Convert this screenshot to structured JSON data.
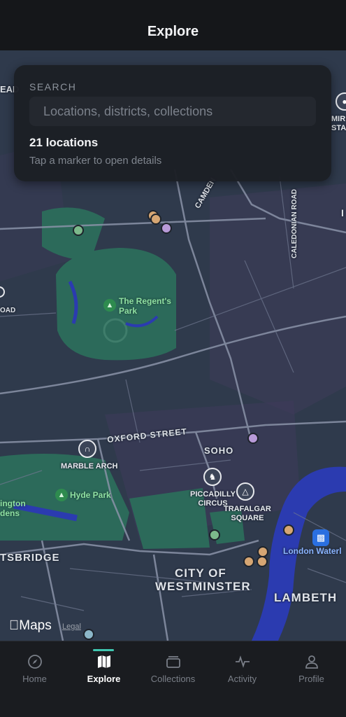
{
  "header": {
    "title": "Explore"
  },
  "search": {
    "label": "SEARCH",
    "placeholder": "Locations, districts, collections",
    "count_text": "21 locations",
    "hint": "Tap a marker to open details"
  },
  "map": {
    "labels": {
      "camden": "CAMDEN",
      "caledonian_road": "CALEDONIAN ROAD",
      "oxford_street": "OXFORD STREET",
      "soho": "SOHO",
      "knightsbridge": "TSBRIDGE",
      "westminster_1": "CITY OF",
      "westminster_2": "WESTMINSTER",
      "lambeth": "LAMBETH",
      "road_left": "OAD",
      "road_top_left": "EAD",
      "edge_right": "I"
    },
    "pois": {
      "regents_park_1": "The Regent's",
      "regents_park_2": "Park",
      "marble_arch": "MARBLE ARCH",
      "hyde_park": "Hyde Park",
      "kensington_1": "ington",
      "kensington_2": "dens",
      "piccadilly_1": "PICCADILLY",
      "piccadilly_2": "CIRCUS",
      "trafalgar_1": "TRAFALGAR",
      "trafalgar_2": "SQUARE",
      "london_waterloo": "London Waterl",
      "mirror_1": "MIR",
      "mirror_2": "STAD"
    },
    "icons": {
      "regents_park": "tree-icon",
      "hyde_park": "tree-icon",
      "marble_arch": "landmark-icon",
      "piccadilly": "statue-icon",
      "trafalgar": "column-icon",
      "waterloo": "train-icon"
    },
    "marker_colors": {
      "tan": "#d6a673",
      "green": "#7cb98b",
      "purple": "#b89ad8",
      "teal": "#8cb7c9"
    },
    "attribution": {
      "brand": "Maps",
      "legal": "Legal"
    }
  },
  "tabs": [
    {
      "label": "Home",
      "icon": "compass-icon"
    },
    {
      "label": "Explore",
      "icon": "map-icon"
    },
    {
      "label": "Collections",
      "icon": "collections-icon"
    },
    {
      "label": "Activity",
      "icon": "activity-icon"
    },
    {
      "label": "Profile",
      "icon": "profile-icon"
    }
  ],
  "colors": {
    "accent": "#3fc7b1",
    "river": "#2b3bb0",
    "park": "#2c6a5a",
    "background": "#2f3a4c"
  }
}
